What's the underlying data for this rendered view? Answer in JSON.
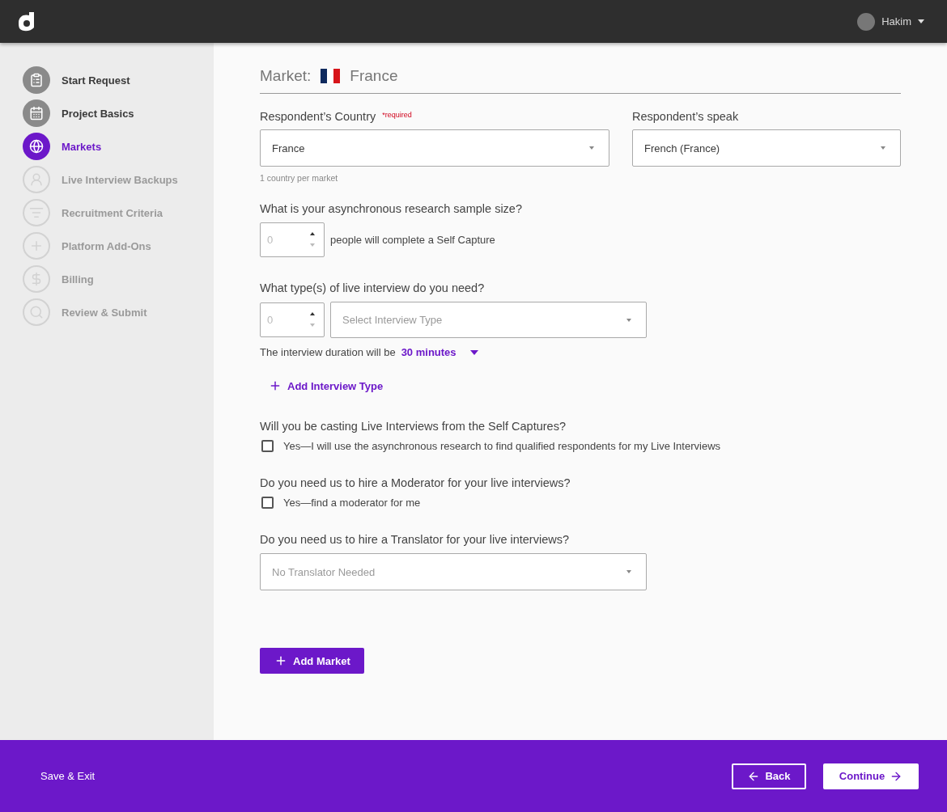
{
  "header": {
    "user_name": "Hakim"
  },
  "steps": [
    {
      "label": "Start Request",
      "completed": true,
      "selected": false
    },
    {
      "label": "Project Basics",
      "completed": true,
      "selected": false
    },
    {
      "label": "Markets",
      "completed": false,
      "selected": true
    },
    {
      "label": "Live Interview Backups",
      "completed": false,
      "selected": false
    },
    {
      "label": "Recruitment Criteria",
      "completed": false,
      "selected": false
    },
    {
      "label": "Platform Add-Ons",
      "completed": false,
      "selected": false
    },
    {
      "label": "Billing",
      "completed": false,
      "selected": false
    },
    {
      "label": "Review & Submit",
      "completed": false,
      "selected": false
    }
  ],
  "market": {
    "label": "Market:",
    "country": "France"
  },
  "country_field": {
    "label": "Respondent’s Country",
    "required": "*required",
    "value": "France",
    "hint": "1 country per market"
  },
  "language_field": {
    "label": "Respondent’s speak",
    "value": "French (France)"
  },
  "sample_size": {
    "question": "What is your asynchronous research sample size?",
    "placeholder": "0",
    "suffix": "people will complete a Self Capture"
  },
  "interview_type": {
    "question": "What type(s) of live interview do you need?",
    "count_placeholder": "0",
    "placeholder": "Select Interview Type",
    "duration_label": "The interview duration will be",
    "duration_value": "30 minutes",
    "add_label": "Add Interview Type"
  },
  "casting": {
    "question": "Will you be casting Live Interviews from the Self Captures?",
    "option": "Yes—I will use the asynchronous research to find qualified respondents for my Live Interviews",
    "checked": false
  },
  "moderator": {
    "question": "Do you need us to hire a Moderator for your live interviews?",
    "option": "Yes—find a moderator for me",
    "checked": false
  },
  "translator": {
    "question": "Do you need us to hire a Translator for your live interviews?",
    "placeholder": "No Translator Needed"
  },
  "add_market": "Add Market",
  "footer": {
    "save_exit": "Save & Exit",
    "back": "Back",
    "continue": "Continue"
  }
}
